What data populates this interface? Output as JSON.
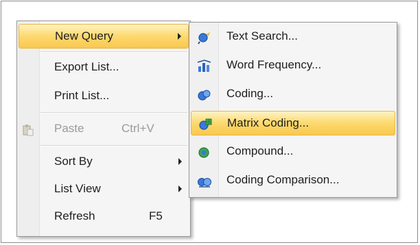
{
  "main_menu": {
    "items": [
      {
        "label": "New Query",
        "highlighted": true,
        "submenu": true
      },
      {
        "label": "Export List..."
      },
      {
        "label": "Print List..."
      },
      {
        "label": "Paste",
        "shortcut": "Ctrl+V",
        "disabled": true,
        "icon": "paste-icon"
      },
      {
        "label": "Sort By",
        "submenu": true
      },
      {
        "label": "List View",
        "submenu": true
      },
      {
        "label": "Refresh",
        "shortcut": "F5"
      }
    ]
  },
  "sub_menu": {
    "items": [
      {
        "label": "Text Search...",
        "icon": "text-search-query-icon"
      },
      {
        "label": "Word Frequency...",
        "icon": "word-frequency-query-icon"
      },
      {
        "label": "Coding...",
        "icon": "coding-query-icon"
      },
      {
        "label": "Matrix Coding...",
        "icon": "matrix-coding-query-icon",
        "highlighted": true
      },
      {
        "label": "Compound...",
        "icon": "compound-query-icon"
      },
      {
        "label": "Coding Comparison...",
        "icon": "coding-comparison-query-icon"
      }
    ]
  },
  "colors": {
    "highlight_top": "#fef3c2",
    "highlight_bottom": "#f9c84f",
    "highlight_border": "#e8b84a",
    "menu_bg": "#f5f5f5",
    "icon_blue": "#2f6fd0",
    "icon_green": "#3fa552"
  }
}
